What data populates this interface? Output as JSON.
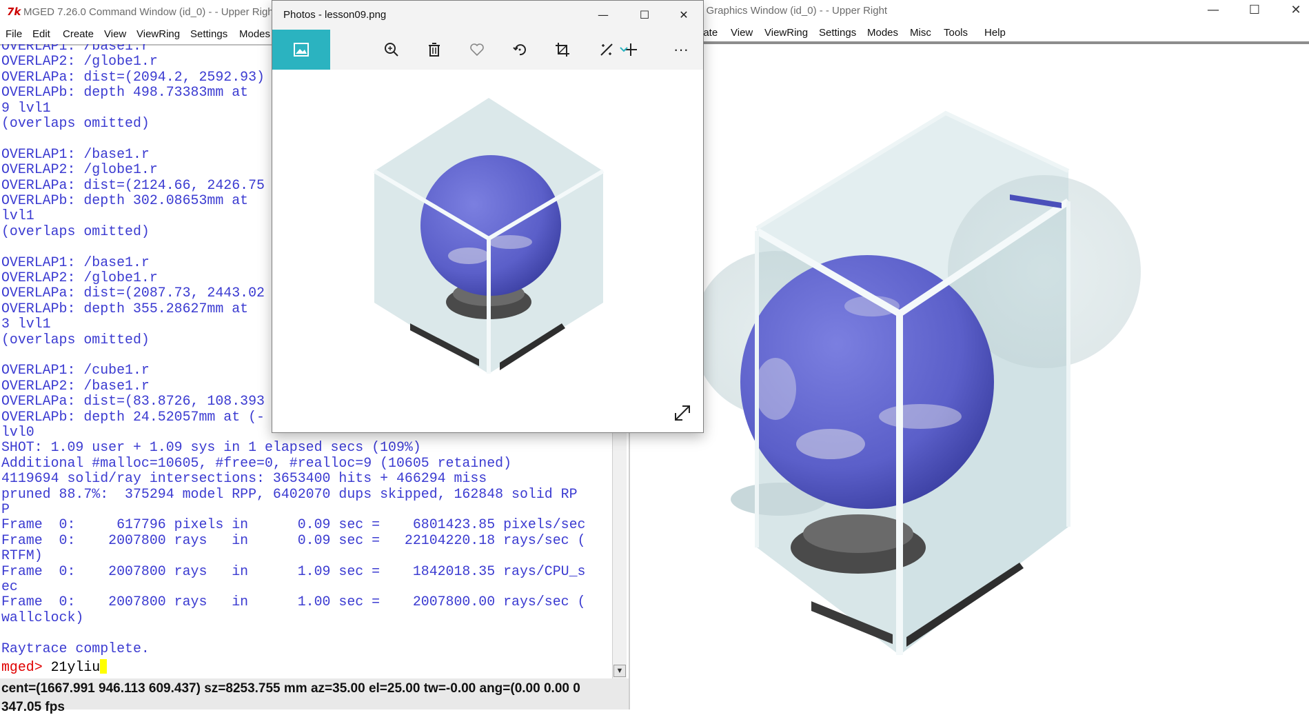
{
  "command_window": {
    "title": "MGED 7.26.0 Command Window (id_0) -  - Upper Right",
    "menu": [
      "File",
      "Edit",
      "Create",
      "View",
      "ViewRing",
      "Settings",
      "Modes"
    ],
    "console_lines": [
      "OVERLAP1: /base1.r",
      "OVERLAP2: /globe1.r",
      "OVERLAPa: dist=(2094.2, 2592.93)",
      "OVERLAPb: depth 498.73383mm at",
      "9 lvl1",
      "(overlaps omitted)",
      "",
      "OVERLAP1: /base1.r",
      "OVERLAP2: /globe1.r",
      "OVERLAPa: dist=(2124.66, 2426.75",
      "OVERLAPb: depth 302.08653mm at",
      "lvl1",
      "(overlaps omitted)",
      "",
      "OVERLAP1: /base1.r",
      "OVERLAP2: /globe1.r",
      "OVERLAPa: dist=(2087.73, 2443.02",
      "OVERLAPb: depth 355.28627mm at",
      "3 lvl1",
      "(overlaps omitted)",
      "",
      "OVERLAP1: /cube1.r",
      "OVERLAP2: /base1.r",
      "OVERLAPa: dist=(83.8726, 108.393",
      "OVERLAPb: depth 24.52057mm at (-",
      "lvl0",
      "SHOT: 1.09 user + 1.09 sys in 1 elapsed secs (109%)",
      "Additional #malloc=10605, #free=0, #realloc=9 (10605 retained)",
      "4119694 solid/ray intersections: 3653400 hits + 466294 miss",
      "pruned 88.7%:  375294 model RPP, 6402070 dups skipped, 162848 solid RP",
      "P",
      "Frame  0:     617796 pixels in      0.09 sec =    6801423.85 pixels/sec",
      "Frame  0:    2007800 rays   in      0.09 sec =   22104220.18 rays/sec (",
      "RTFM)",
      "Frame  0:    2007800 rays   in      1.09 sec =    1842018.35 rays/CPU_s",
      "ec",
      "Frame  0:    2007800 rays   in      1.00 sec =    2007800.00 rays/sec (",
      "wallclock)",
      "",
      "Raytrace complete."
    ],
    "prompt": "mged> ",
    "input_value": "21yliu",
    "status_line1": "cent=(1667.991 946.113 609.437) sz=8253.755  mm  az=35.00  el=25.00  tw=-0.00  ang=(0.00 0.00 0",
    "status_line2": "347.05 fps"
  },
  "graphics_window": {
    "title": "0 Graphics Window (id_0) -  - Upper Right",
    "menu": [
      "eate",
      "View",
      "ViewRing",
      "Settings",
      "Modes",
      "Misc",
      "Tools",
      "Help"
    ],
    "controls": {
      "minimize": "—",
      "maximize": "☐",
      "close": "✕"
    }
  },
  "photos_window": {
    "title": "Photos - lesson09.png",
    "controls": {
      "minimize": "—",
      "maximize": "☐",
      "close": "✕"
    },
    "toolbar": [
      "image-icon",
      "add-icon",
      "zoom-icon",
      "delete-icon",
      "heart-icon",
      "rotate-icon",
      "crop-icon",
      "edit-icon",
      "more-icon"
    ],
    "more_label": "···"
  },
  "colors": {
    "console_text": "#3b3bd1",
    "prompt": "#e00000",
    "accent": "#2bb3c0",
    "globe": "#5b5fc9",
    "glass": "#dbe8ea"
  }
}
